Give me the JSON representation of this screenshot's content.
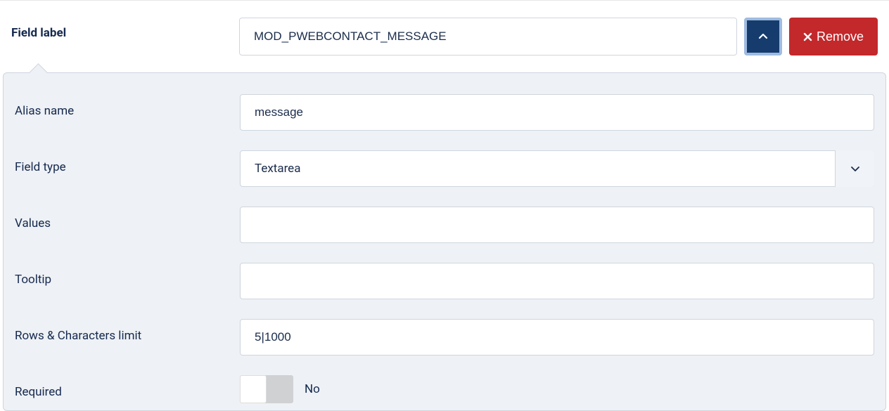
{
  "header": {
    "field_label_text": "Field label",
    "field_label_value": "MOD_PWEBCONTACT_MESSAGE",
    "remove_label": "Remove"
  },
  "panel": {
    "alias": {
      "label": "Alias name",
      "value": "message"
    },
    "field_type": {
      "label": "Field type",
      "value": "Textarea"
    },
    "values": {
      "label": "Values",
      "value": ""
    },
    "tooltip": {
      "label": "Tooltip",
      "value": ""
    },
    "rows_limit": {
      "label": "Rows & Characters limit",
      "value": "5|1000"
    },
    "required": {
      "label": "Required",
      "state_label": "No",
      "state": false
    }
  }
}
